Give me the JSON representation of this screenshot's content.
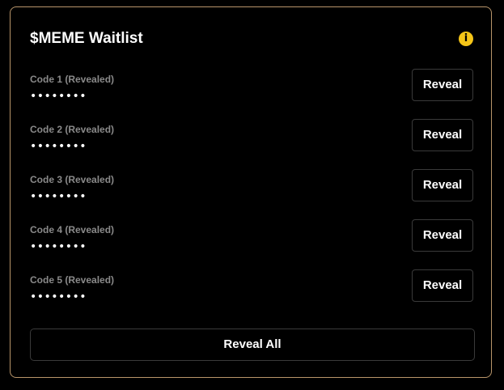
{
  "card": {
    "title": "$MEME Waitlist",
    "info_icon": "i"
  },
  "codes": [
    {
      "label": "Code 1 (Revealed)",
      "value": "••••••••",
      "button_label": "Reveal"
    },
    {
      "label": "Code 2 (Revealed)",
      "value": "••••••••",
      "button_label": "Reveal"
    },
    {
      "label": "Code 3 (Revealed)",
      "value": "••••••••",
      "button_label": "Reveal"
    },
    {
      "label": "Code 4 (Revealed)",
      "value": "••••••••",
      "button_label": "Reveal"
    },
    {
      "label": "Code 5 (Revealed)",
      "value": "••••••••",
      "button_label": "Reveal"
    }
  ],
  "reveal_all_label": "Reveal All",
  "colors": {
    "background": "#000000",
    "card_border": "#b8956a",
    "info_icon": "#f5c518",
    "label_text": "#8a8a8a",
    "button_border": "#3a3a3a"
  }
}
